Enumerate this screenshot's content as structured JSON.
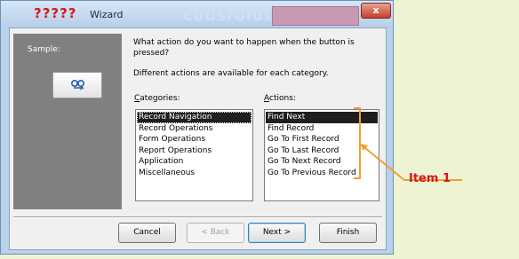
{
  "window": {
    "title_mark": "?????",
    "title": "Wizard",
    "close_symbol": "x",
    "ghost_title": "cousrolution form"
  },
  "sample": {
    "label": "Sample:"
  },
  "wizard": {
    "question": "What action do you want to happen when the button is pressed?",
    "subtext": "Different actions are available for each category.",
    "categories_label_accel": "C",
    "categories_label_rest": "ategories:",
    "actions_label_accel": "A",
    "actions_label_rest": "ctions:",
    "categories": [
      "Record Navigation",
      "Record Operations",
      "Form Operations",
      "Report Operations",
      "Application",
      "Miscellaneous"
    ],
    "actions": [
      "Find Next",
      "Find Record",
      "Go To First Record",
      "Go To Last Record",
      "Go To Next Record",
      "Go To Previous Record"
    ]
  },
  "buttons": {
    "cancel": "Cancel",
    "back": "< Back",
    "next": "Next >",
    "finish": "Finish"
  },
  "annotation": {
    "label": "Item 1",
    "color": "#d51818",
    "bracket_color": "#f0a030"
  }
}
